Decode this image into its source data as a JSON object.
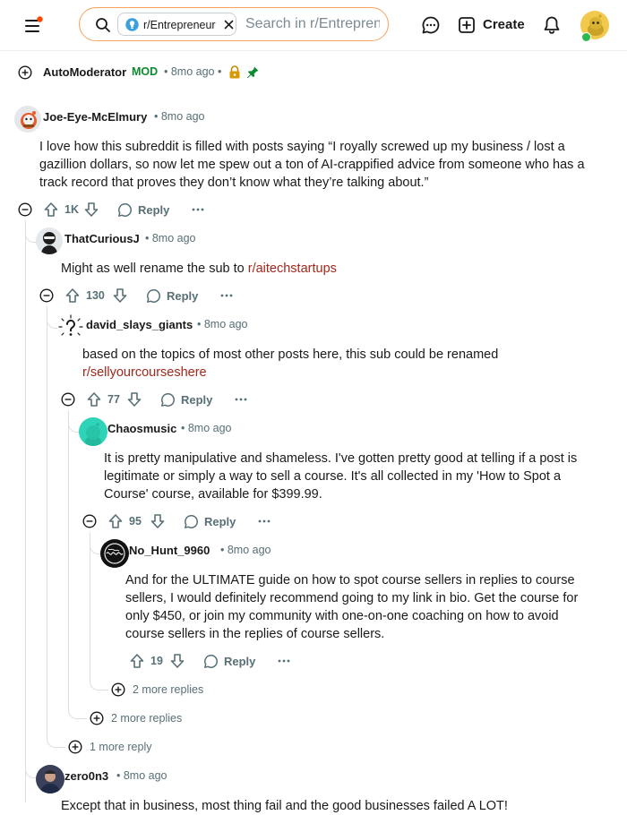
{
  "header": {
    "community_chip": "r/Entrepreneur",
    "search_placeholder": "Search in r/Entrepreneur",
    "create_label": "Create",
    "colors": {
      "search_border": "#f5a35f",
      "avatar_bg": "#f2c94c",
      "online_dot": "#2db84d",
      "notify_dot": "#ff4500"
    }
  },
  "thread": {
    "pinned": {
      "author": "AutoModerator",
      "mod_badge": "MOD",
      "time": "8mo ago",
      "icons": [
        "lock-icon",
        "pin-icon"
      ]
    },
    "comments": [
      {
        "author": "Joe-Eye-McElmury",
        "time": "8mo ago",
        "body": "I love how this subreddit is filled with posts saying “I royally screwed up my business / lost a gazillion dollars, so now let me spew out a ton of AI-crappified advice from someone who has a track record that proves they don’t know what they’re talking about.”",
        "votes": "1K",
        "reply_label": "Reply"
      },
      {
        "author": "ThatCuriousJ",
        "time": "8mo ago",
        "body": "Might as well rename the sub to ",
        "body_link": "r/aitechstartups",
        "votes": "130",
        "reply_label": "Reply"
      },
      {
        "author": "david_slays_giants",
        "time": "8mo ago",
        "body": "based on the topics of most other posts here, this sub could be renamed",
        "body_link": "r/sellyourcourseshere",
        "votes": "77",
        "reply_label": "Reply"
      },
      {
        "author": "Chaosmusic",
        "time": "8mo ago",
        "body": "It is pretty manipulative and shameless. I've gotten pretty good at telling if a post is legitimate or simply a way to sell a course. It's all collected in my 'How to Spot a Course' course, available for $399.99.",
        "votes": "95",
        "reply_label": "Reply"
      },
      {
        "author": "No_Hunt_9960",
        "time": "8mo ago",
        "body": "And for the ULTIMATE guide on how to spot course sellers in replies to course sellers, I would definitely recommend going to my link in bio. Get the course for only $450, or join my community with one-on-one coaching on how to avoid course sellers in the replies of course sellers.",
        "votes": "19",
        "reply_label": "Reply"
      },
      {
        "author": "zero0n3",
        "time": "8mo ago",
        "body": "Except that in business, most thing fail and the good businesses failed A LOT!"
      }
    ],
    "more_replies": [
      {
        "label": "2 more replies"
      },
      {
        "label": "2 more replies"
      },
      {
        "label": "1 more reply"
      }
    ]
  }
}
